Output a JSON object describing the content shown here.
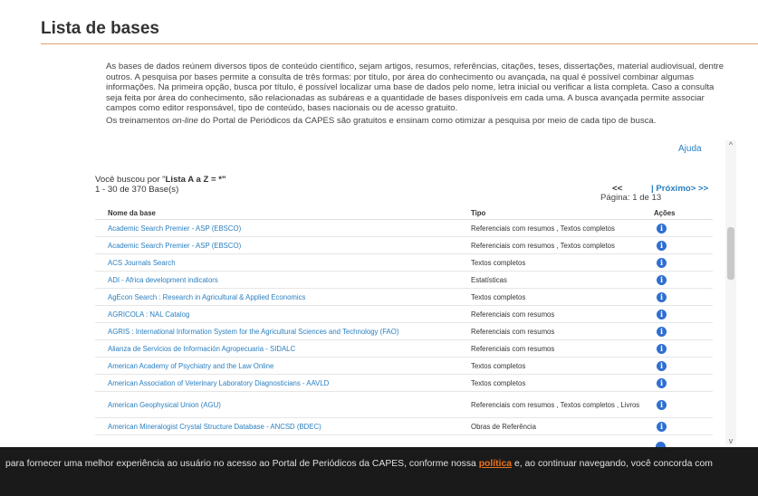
{
  "header": {
    "title": "Lista de bases"
  },
  "intro": {
    "paragraph1": "As bases de dados reúnem diversos tipos de conteúdo científico, sejam artigos, resumos, referências, citações, teses, dissertações, material audiovisual, dentre outros. A pesquisa por bases permite a consulta de três formas: por título, por área do conhecimento ou avançada, na qual é possível combinar algumas informações. Na primeira opção, busca por título, é possível localizar uma base de dados pelo nome, letra inicial ou verificar a lista completa. Caso a consulta seja feita por área do conhecimento, são relacionadas as subáreas e a quantidade de bases disponíveis em cada uma. A busca avançada permite associar campos como editor responsável, tipo de conteúdo, bases nacionais ou de acesso gratuito.",
    "paragraph2_before": "Os treinamentos ",
    "paragraph2_italic": "on-line",
    "paragraph2_after": " do Portal de Periódicos da CAPES são gratuitos e ensinam como otimizar a pesquisa por meio de cada tipo de busca."
  },
  "help_link": "Ajuda",
  "search": {
    "prefix": "Você buscou por \"",
    "query": "Lista A a Z = *",
    "suffix": "\"",
    "result_count": "1 - 30 de 370 Base(s)"
  },
  "pagination": {
    "prev": "<<",
    "next": "| Próximo> >>",
    "page_info": "Página: 1 de 13"
  },
  "table": {
    "headers": {
      "name": "Nome da base",
      "tipo": "Tipo",
      "acoes": "Ações"
    },
    "rows": [
      {
        "name": "Academic Search Premier - ASP (EBSCO)",
        "tipo": "Referenciais com resumos , Textos completos"
      },
      {
        "name": "Academic Search Premier - ASP (EBSCO)",
        "tipo": "Referenciais com resumos , Textos completos"
      },
      {
        "name": "ACS Journals Search",
        "tipo": "Textos completos"
      },
      {
        "name": "ADI - Africa development indicators",
        "tipo": "Estatísticas"
      },
      {
        "name": "AgEcon Search : Research in Agricultural & Applied Economics",
        "tipo": "Textos completos"
      },
      {
        "name": "AGRICOLA : NAL Catalog",
        "tipo": "Referenciais com resumos"
      },
      {
        "name": "AGRIS : International Information System for the Agricultural Sciences and Technology (FAO)",
        "tipo": "Referenciais com resumos"
      },
      {
        "name": "Alianza de Servicios de Información Agropecuaria - SIDALC",
        "tipo": "Referenciais com resumos"
      },
      {
        "name": "American Academy of Psychiatry and the Law Online",
        "tipo": "Textos completos"
      },
      {
        "name": "American Association of Veterinary Laboratory Diagnosticians - AAVLD",
        "tipo": "Textos completos"
      },
      {
        "name": "American Geophysical Union (AGU)",
        "tipo": "Referenciais com resumos , Textos completos , Livros"
      },
      {
        "name": "American Mineralogist Crystal Structure Database - ANCSD (BDEC)",
        "tipo": "Obras de Referência"
      }
    ],
    "info_glyph": "i"
  },
  "scrollbar": {
    "up_arrow": "^",
    "down_arrow": "v"
  },
  "cookie": {
    "before": "para fornecer uma melhor experiência ao usuário no acesso ao Portal de Periódicos da CAPES, conforme nossa ",
    "link": "política",
    "after": " e, ao continuar navegando, você concorda com"
  }
}
